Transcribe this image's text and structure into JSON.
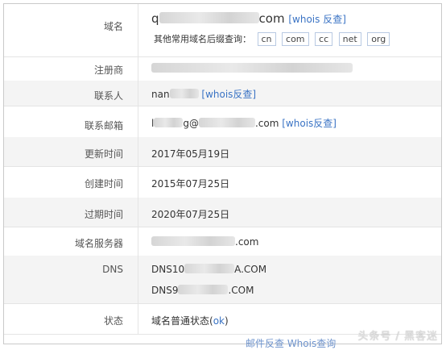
{
  "rows": {
    "domain": {
      "label": "域名",
      "suffix": "com",
      "whois": "[whois 反查]"
    },
    "suffix_line": {
      "label": "其他常用域名后缀查询：",
      "tags": [
        "cn",
        "com",
        "cc",
        "net",
        "org"
      ]
    },
    "registrar": {
      "label": "注册商"
    },
    "contact": {
      "label": "联系人",
      "prefix": "nan",
      "whois": "[whois反查]"
    },
    "email": {
      "label": "联系邮箱",
      "prefix": "l",
      "mid": "g@",
      "suffix": ".com",
      "whois": "[whois反查]"
    },
    "updated": {
      "label": "更新时间",
      "value": "2017年05月19日"
    },
    "created": {
      "label": "创建时间",
      "value": "2015年07月25日"
    },
    "expires": {
      "label": "过期时间",
      "value": "2020年07月25日"
    },
    "nameserver": {
      "label": "域名服务器",
      "suffix": ".com"
    },
    "dns": {
      "label": "DNS",
      "line1_prefix": "DNS10",
      "line1_suffix": "A.COM",
      "line2_prefix": "DNS9",
      "line2_suffix": ".COM"
    },
    "status": {
      "label": "状态",
      "value_text": "域名普通状态(",
      "value_link": "ok",
      "value_end": ")"
    }
  },
  "bottom_link": "邮件反查 Whois查询",
  "watermark": "头条号 / 黑客迷"
}
